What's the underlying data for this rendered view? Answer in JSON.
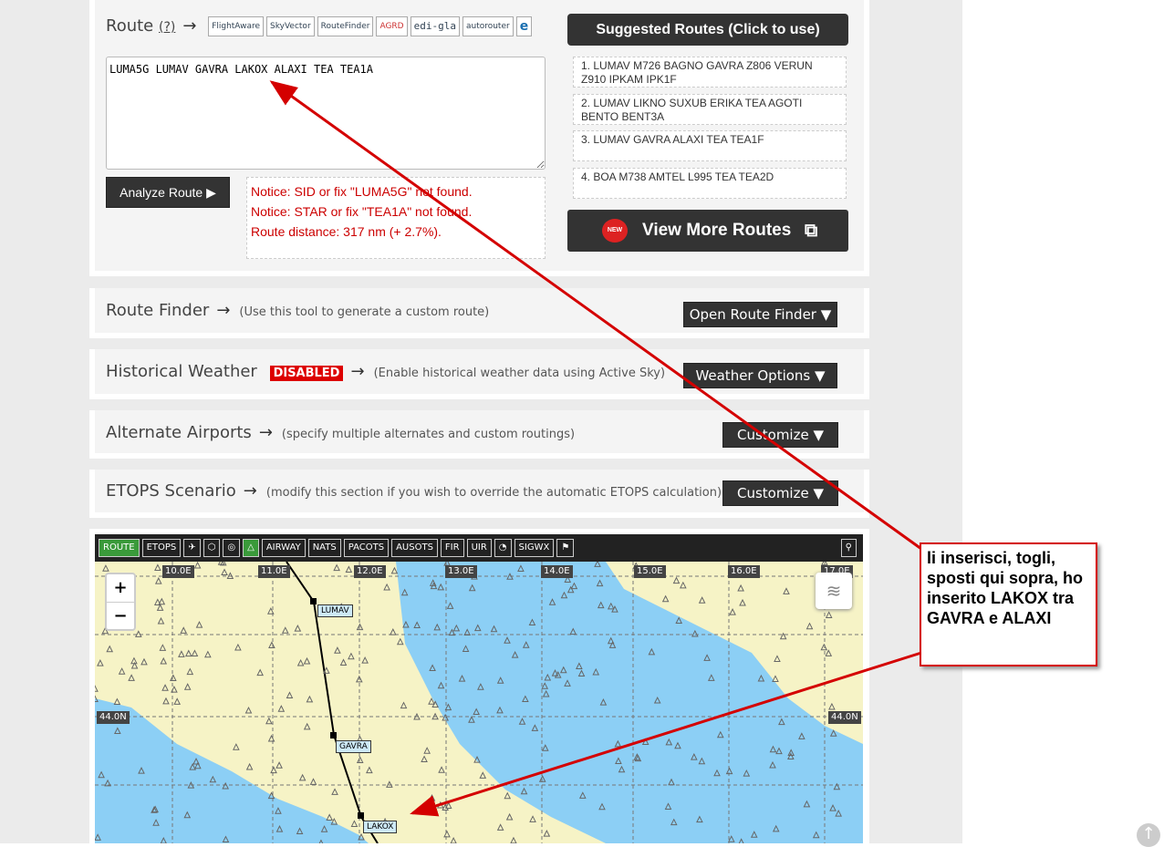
{
  "route": {
    "title": "Route",
    "help": "(?)",
    "arrow": "→",
    "logos": [
      "FlightAware",
      "SkyVector",
      "RouteFinder",
      "AGRD",
      "edi-gla",
      "autorouter",
      "e"
    ],
    "value": "LUMA5G LUMAV GAVRA LAKOX ALAXI TEA TEA1A",
    "analyze_label": "Analyze Route ▶",
    "notices": [
      "Notice: SID or fix \"LUMA5G\" not found.",
      "Notice: STAR or fix \"TEA1A\" not found.",
      "Route distance: 317 nm (+ 2.7%)."
    ],
    "suggested_title": "Suggested Routes (Click to use)",
    "suggested": [
      "1.  LUMAV M726 BAGNO GAVRA Z806 VERUN Z910 IPKAM IPK1F",
      "2.  LUMAV LIKNO SUXUB ERIKA TEA AGOTI BENTO BENT3A",
      "3.  LUMAV GAVRA ALAXI TEA TEA1F",
      "4.  BOA M738 AMTEL L995 TEA TEA2D"
    ],
    "new_badge": "NEW",
    "view_more": "View More Routes"
  },
  "route_finder": {
    "title": "Route Finder",
    "arrow": "→",
    "desc": "(Use this tool to generate a custom route)",
    "button": "Open Route Finder ▼"
  },
  "weather": {
    "title": "Historical Weather",
    "badge": "DISABLED",
    "arrow": "→",
    "desc": "(Enable historical weather data using Active Sky)",
    "button": "Weather Options ▼"
  },
  "alternates": {
    "title": "Alternate Airports",
    "arrow": "→",
    "desc": "(specify multiple alternates and custom routings)",
    "button": "Customize ▼"
  },
  "etops": {
    "title": "ETOPS Scenario",
    "arrow": "→",
    "desc": "(modify this section if you wish to override the automatic ETOPS calculation)",
    "button": "Customize ▼"
  },
  "map": {
    "toolbar": [
      "ROUTE",
      "ETOPS",
      "AIRWAY",
      "NATS",
      "PACOTS",
      "AUSOTS",
      "FIR",
      "UIR",
      "SIGWX"
    ],
    "lon_labels": [
      "10.0E",
      "11.0E",
      "12.0E",
      "13.0E",
      "14.0E",
      "15.0E",
      "16.0E",
      "17.0E"
    ],
    "lat_label": "44.0N",
    "waypoints": [
      "LUMAV",
      "GAVRA",
      "LAKOX"
    ],
    "zoom_in": "+",
    "zoom_out": "−"
  },
  "annotation": {
    "text": "li inserisci, togli, sposti qui sopra, ho inserito LAKOX tra GAVRA e ALAXI",
    "color": "#d40000"
  }
}
